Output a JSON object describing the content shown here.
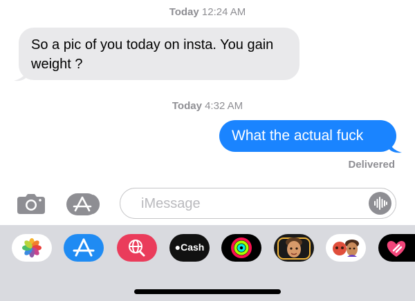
{
  "thread": {
    "timestamp1_day": "Today",
    "timestamp1_time": "12:24 AM",
    "incoming_message": "So a pic of you today on insta. You gain weight ?",
    "timestamp2_day": "Today",
    "timestamp2_time": "4:32 AM",
    "outgoing_message": "What the actual fuck",
    "delivery_status": "Delivered"
  },
  "composer": {
    "placeholder": "iMessage",
    "camera_icon": "camera-icon",
    "appstore_icon": "app-store-icon",
    "audio_icon": "audio-waveform-icon"
  },
  "app_tray": {
    "cash_label": "Cash",
    "apps": [
      "photos",
      "app-store",
      "web-images",
      "apple-cash",
      "activity",
      "memoji",
      "animoji-stickers",
      "digital-touch"
    ]
  },
  "colors": {
    "incoming_bubble": "#e9e9eb",
    "outgoing_bubble": "#1a84ff",
    "tray_background": "#d9dadf",
    "meta_text": "#8e8e93"
  }
}
